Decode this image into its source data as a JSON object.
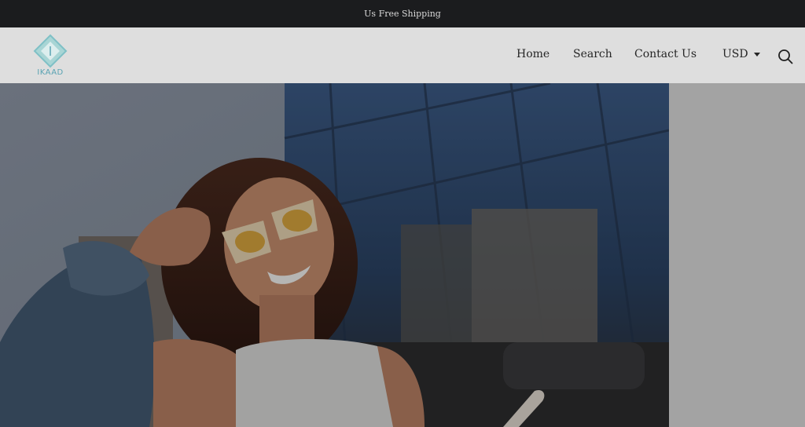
{
  "announcement": {
    "text": "Us Free Shipping"
  },
  "brand": {
    "logo_text": "IKAAD"
  },
  "nav": {
    "items": [
      {
        "label": "Home"
      },
      {
        "label": "Search"
      },
      {
        "label": "Contact Us"
      }
    ]
  },
  "currency": {
    "selected": "USD"
  },
  "icons": {
    "search": "search-icon",
    "caret": "chevron-down-icon"
  },
  "colors": {
    "topbar": "#1b1c1e",
    "header": "#dedede",
    "side_panel": "#a3a3a3",
    "logo": "#5aa3b3"
  },
  "hero": {
    "image": "woman-with-yellow-sunglasses-photo"
  }
}
